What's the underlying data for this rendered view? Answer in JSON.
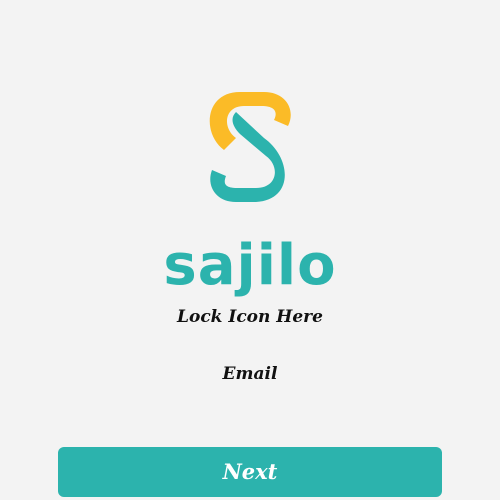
{
  "app": {
    "brand_name": "sajilo"
  },
  "colors": {
    "background": "#f3f3f3",
    "brand_teal": "#2cb3ad",
    "brand_yellow": "#fbbb27",
    "text": "#111111",
    "button_text": "#ffffff"
  },
  "logo": {
    "icon": "sajilo-s-logo-icon"
  },
  "main": {
    "lock_placeholder": "Lock Icon Here",
    "email_label": "Email"
  },
  "actions": {
    "next_label": "Next"
  }
}
